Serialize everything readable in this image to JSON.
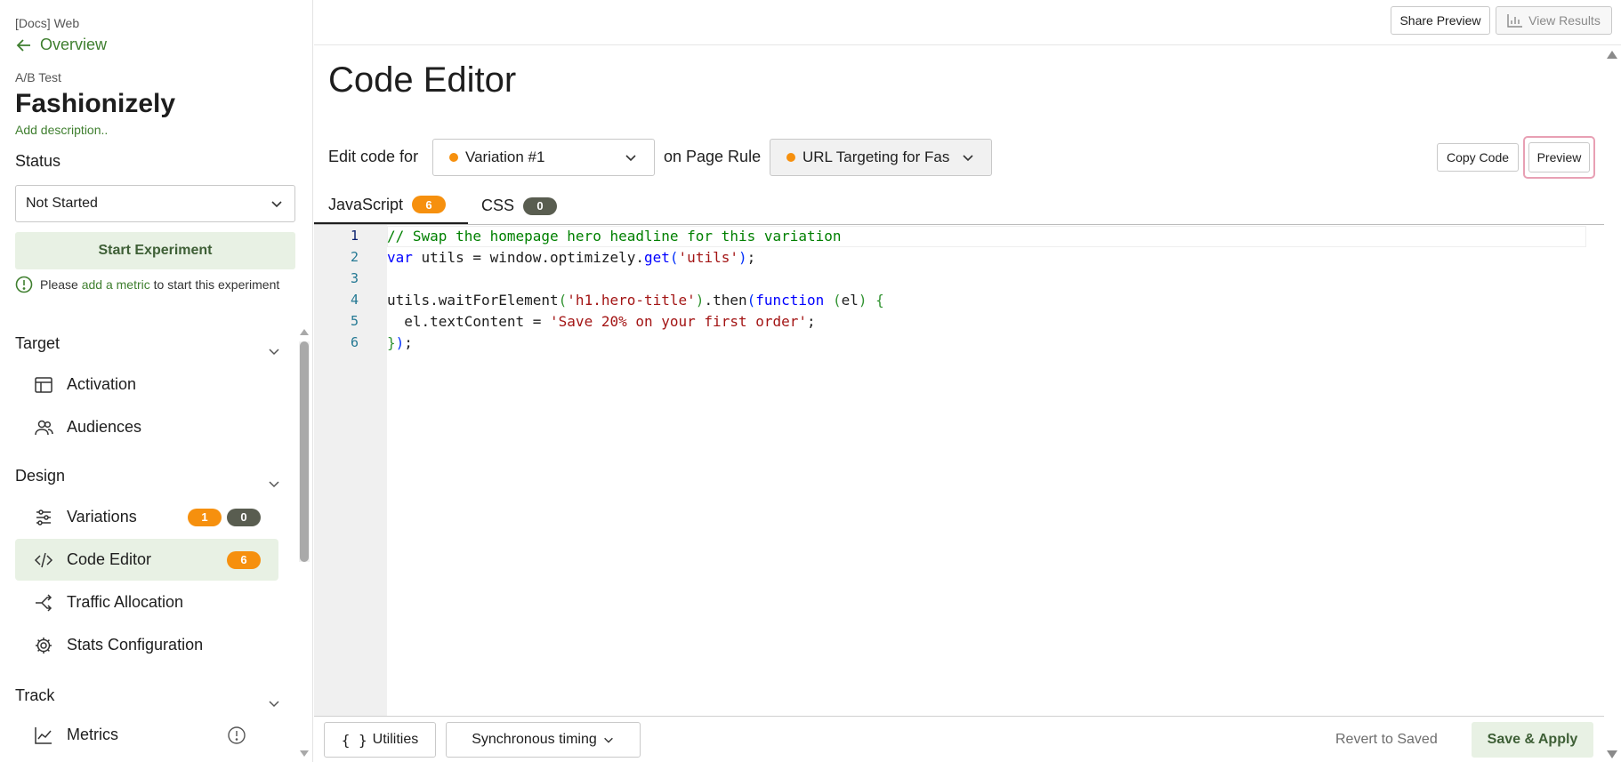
{
  "sidebar": {
    "project": "[Docs] Web",
    "back_label": "Overview",
    "experiment_type": "A/B Test",
    "experiment_name": "Fashionizely",
    "add_description": "Add description..",
    "status_label": "Status",
    "status_value": "Not Started",
    "start_button": "Start Experiment",
    "notice_prefix": "Please ",
    "notice_link": "add a metric",
    "notice_suffix": " to start this experiment",
    "sections": {
      "target": {
        "title": "Target",
        "items": [
          {
            "label": "Activation",
            "icon": "layout-icon"
          },
          {
            "label": "Audiences",
            "icon": "users-icon"
          }
        ]
      },
      "design": {
        "title": "Design",
        "items": [
          {
            "label": "Variations",
            "icon": "sliders-icon",
            "badges": [
              "1",
              "0"
            ]
          },
          {
            "label": "Code Editor",
            "icon": "code-icon",
            "badges": [
              "6"
            ],
            "active": true
          },
          {
            "label": "Traffic Allocation",
            "icon": "split-icon"
          },
          {
            "label": "Stats Configuration",
            "icon": "gear-icon"
          }
        ]
      },
      "track": {
        "title": "Track",
        "items": [
          {
            "label": "Metrics",
            "icon": "chart-line-icon"
          }
        ]
      }
    }
  },
  "topbar": {
    "share_preview": "Share Preview",
    "view_results": "View Results"
  },
  "main": {
    "title": "Code Editor",
    "edit_code_for": "Edit code for",
    "variation_select": "Variation #1",
    "on_page_rule": "on Page Rule",
    "page_rule_select": "URL Targeting for Fas",
    "copy_code": "Copy Code",
    "preview": "Preview",
    "tabs": [
      {
        "label": "JavaScript",
        "count": "6",
        "active": true
      },
      {
        "label": "CSS",
        "count": "0",
        "active": false
      }
    ],
    "line_numbers": [
      "1",
      "2",
      "3",
      "4",
      "5",
      "6"
    ],
    "code": [
      "// Swap the homepage hero headline for this variation",
      "var utils = window.optimizely.get('utils');",
      "",
      "utils.waitForElement('h1.hero-title').then(function (el) {",
      "  el.textContent = 'Save 20% on your first order';",
      "});"
    ]
  },
  "bottombar": {
    "utilities": "Utilities",
    "timing": "Synchronous timing",
    "revert": "Revert to Saved",
    "save": "Save & Apply"
  },
  "colors": {
    "accent_green": "#3f7f2f",
    "badge_orange": "#f6900e",
    "badge_dark": "#595d50",
    "active_bg": "#e8f1e4",
    "preview_outline": "#e8a0b4"
  }
}
